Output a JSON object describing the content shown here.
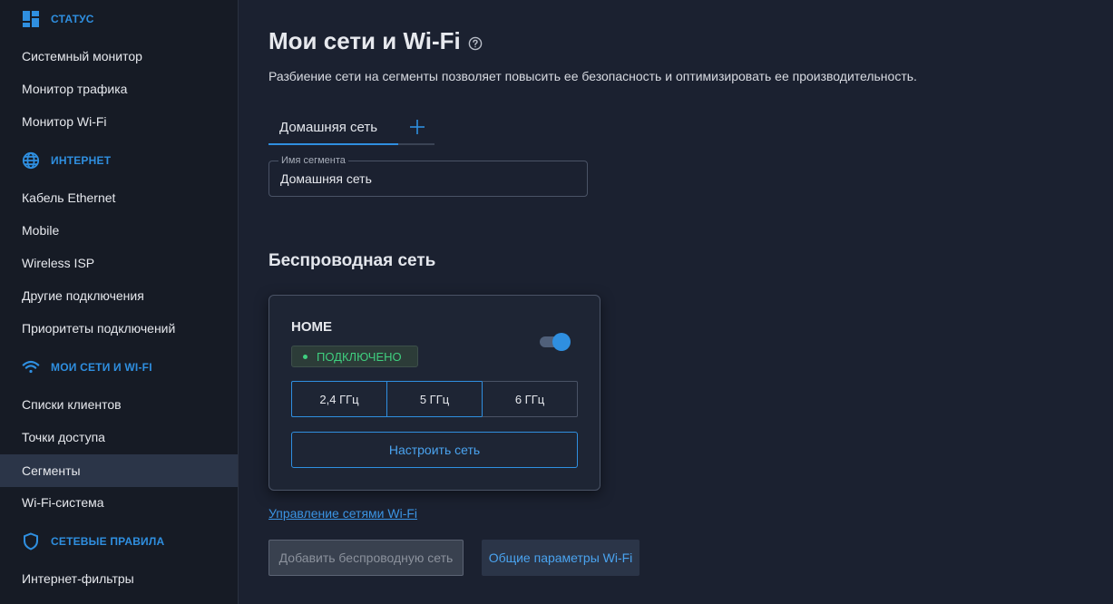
{
  "colors": {
    "accent": "#2f8fe0",
    "status_ok": "#3fcf7f",
    "sidebar_bg": "#161b25",
    "main_bg": "#1b2130",
    "active_nav_bg": "#2b3548"
  },
  "sidebar": {
    "sections": [
      {
        "title": "СТАТУС",
        "icon": "dashboard-icon",
        "items": [
          "Системный монитор",
          "Монитор трафика",
          "Монитор Wi-Fi"
        ]
      },
      {
        "title": "ИНТЕРНЕТ",
        "icon": "globe-icon",
        "items": [
          "Кабель Ethernet",
          "Mobile",
          "Wireless ISP",
          "Другие подключения",
          "Приоритеты подключений"
        ]
      },
      {
        "title": "МОИ СЕТИ И WI-FI",
        "icon": "wifi-icon",
        "items": [
          "Списки клиентов",
          "Точки доступа",
          "Сегменты",
          "Wi-Fi-система"
        ]
      },
      {
        "title": "СЕТЕВЫЕ ПРАВИЛА",
        "icon": "shield-icon",
        "items": [
          "Интернет-фильтры"
        ]
      }
    ],
    "active_item": "Сегменты"
  },
  "main": {
    "title": "Мои сети и Wi-Fi",
    "help_icon": "help-circle-icon",
    "subtitle": "Разбиение сети на сегменты позволяет повысить ее безопасность и оптимизировать ее производительность.",
    "tabs": [
      {
        "label": "Домашняя сеть",
        "active": true
      }
    ],
    "add_tab_icon": "plus-icon",
    "segment_name": {
      "label": "Имя сегмента",
      "value": "Домашняя сеть"
    },
    "wireless_section_title": "Беспроводная сеть",
    "network_card": {
      "name": "HOME",
      "status": "ПОДКЛЮЧЕНО",
      "enabled": true,
      "bands": [
        "2,4 ГГц",
        "5 ГГц",
        "6 ГГц"
      ],
      "configure_label": "Настроить сеть"
    },
    "manage_link": "Управление сетями Wi-Fi",
    "add_network_label": "Добавить беспроводную сеть",
    "general_params_label": "Общие параметры Wi-Fi"
  }
}
